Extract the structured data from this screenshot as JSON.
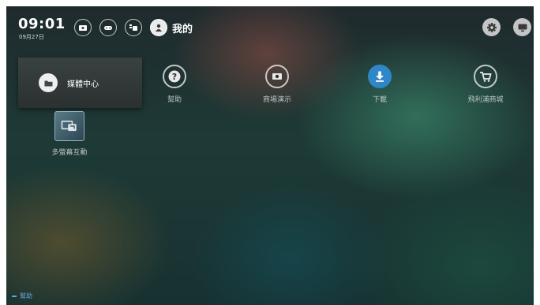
{
  "status": {
    "time": "09:01",
    "date": "09月27日"
  },
  "top_nav": {
    "icons": [
      "tv-icon",
      "gamepad-icon",
      "apps-icon",
      "user-icon"
    ],
    "active_label": "我的"
  },
  "right_icons": [
    "gear-icon",
    "monitor-icon"
  ],
  "selected_tile": {
    "label": "媒體中心",
    "icon": "folder-icon"
  },
  "tiles": [
    {
      "label": "幫助",
      "icon": "help-icon"
    },
    {
      "label": "商場演示",
      "icon": "video-icon"
    },
    {
      "label": "下載",
      "icon": "download-icon"
    },
    {
      "label": "飛利浦商城",
      "icon": "cart-icon"
    }
  ],
  "app": {
    "label": "多螢幕互動",
    "icon": "multiscreen-icon"
  },
  "footer": {
    "help_label": "幫助"
  },
  "colors": {
    "accent_blue": "#2f86c8",
    "hint_blue": "#5fa3d8"
  }
}
